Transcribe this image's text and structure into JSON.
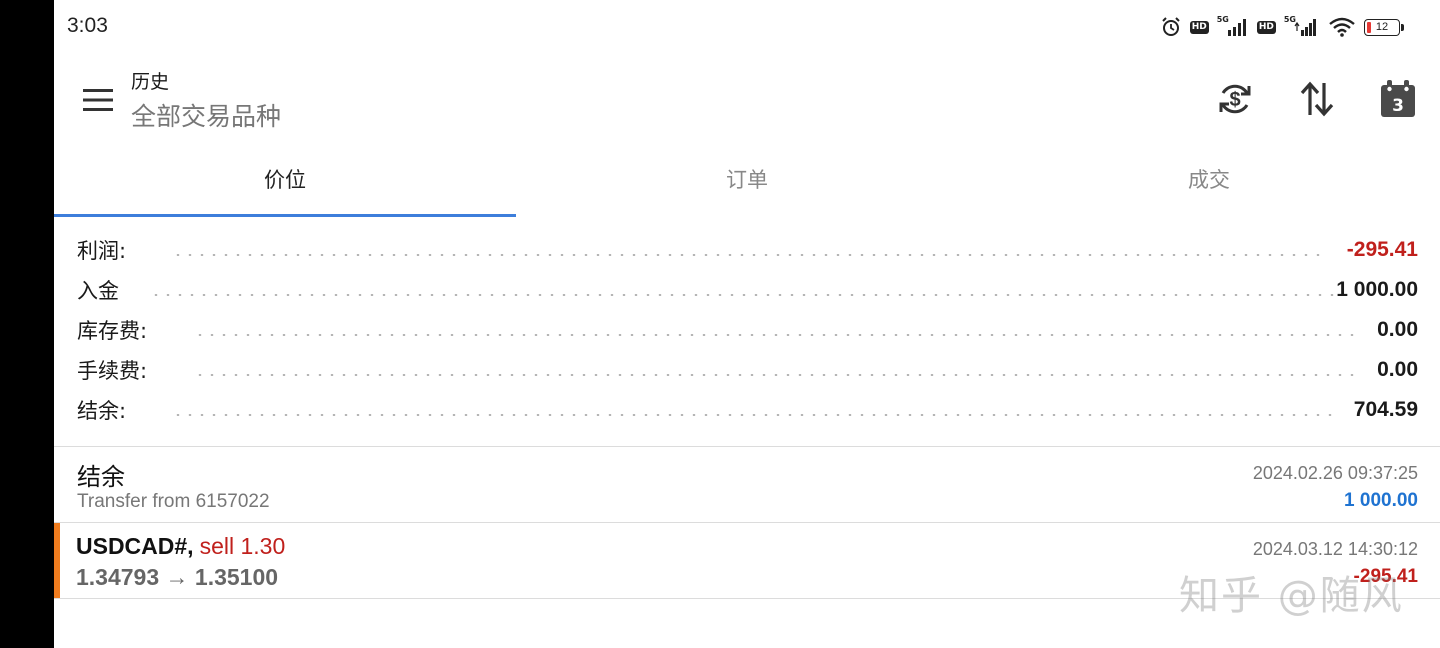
{
  "status_bar": {
    "time": "3:03",
    "icons": [
      "alarm-icon",
      "hd-icon",
      "signal-5g-icon",
      "hd-icon",
      "signal-5g-icon",
      "wifi-icon",
      "battery-icon"
    ],
    "network": "5G",
    "hd": "HD",
    "battery": "12"
  },
  "header": {
    "title": "历史",
    "subtitle": "全部交易品种",
    "menu_icon": "hamburger-menu-icon",
    "actions": [
      "currency-sync-icon",
      "sort-icon",
      "calendar-icon"
    ],
    "calendar_day": "3"
  },
  "tabs": {
    "items": [
      "价位",
      "订单",
      "成交"
    ],
    "active": 0,
    "accent": "#3d7edb"
  },
  "summary": {
    "rows": [
      {
        "label": "利润:",
        "value": "-295.41"
      },
      {
        "label": "入金",
        "value": "1 000.00"
      },
      {
        "label": "库存费:",
        "value": "0.00"
      },
      {
        "label": "手续费:",
        "value": "0.00"
      },
      {
        "label": "结余:",
        "value": "704.59"
      }
    ],
    "negative_color": "#c0201c"
  },
  "history": {
    "balance_entry": {
      "title": "结余",
      "subtitle": "Transfer from 6157022",
      "time": "2024.02.26 09:37:25",
      "amount": "1 000.00",
      "amount_color": "#1f73d1"
    },
    "deal_entry": {
      "symbol": "USDCAD#,",
      "type": "sell 1.30",
      "prices": "1.34793 → 1.35100",
      "time": "2024.03.12 14:30:12",
      "profit": "-295.41",
      "marker_color": "#f07c1e"
    }
  },
  "watermark": "知乎 @随风"
}
